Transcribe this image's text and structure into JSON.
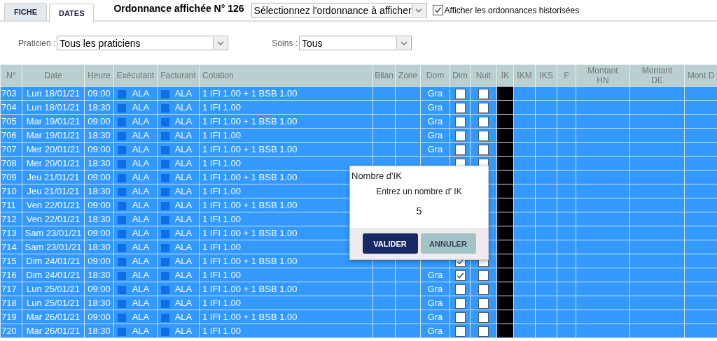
{
  "tabs": [
    {
      "label": "FICHE",
      "selected": false
    },
    {
      "label": "DATES",
      "selected": true
    }
  ],
  "title": "Ordonnance affichée N° 126",
  "ordonnance_select": {
    "value": "Sélectionnez l'ordonnance à afficher"
  },
  "show_history": {
    "label": "Afficher les ordonnances historisées",
    "checked": true
  },
  "filters": [
    {
      "label": "Praticien :",
      "value": "Tous les praticiens"
    },
    {
      "label": "Soins :",
      "value": "Tous"
    }
  ],
  "table": {
    "columns": [
      "N°",
      "Date",
      "Heure",
      "Exécutant",
      "Facturant",
      "Cotation",
      "Bilan",
      "Zone",
      "Dom",
      "Dim",
      "Nuit",
      "IK",
      "IKM",
      "IKS",
      "F",
      "Montant HN",
      "Montant DE",
      "Mont D"
    ],
    "rows": [
      {
        "num": "703",
        "date": "Lun 18/01/21",
        "time": "09:00",
        "executant": "ALA",
        "facturant": "ALA",
        "cotation": "1 IFI 1.00 + 1 BSB 1.00",
        "dom": "Gra",
        "dim": false,
        "nuit": false
      },
      {
        "num": "704",
        "date": "Lun 18/01/21",
        "time": "18:30",
        "executant": "ALA",
        "facturant": "ALA",
        "cotation": "1 IFI 1.00",
        "dom": "Gra",
        "dim": false,
        "nuit": false
      },
      {
        "num": "705",
        "date": "Mar 19/01/21",
        "time": "09:00",
        "executant": "ALA",
        "facturant": "ALA",
        "cotation": "1 IFI 1.00 + 1 BSB 1.00",
        "dom": "Gra",
        "dim": false,
        "nuit": false
      },
      {
        "num": "706",
        "date": "Mar 19/01/21",
        "time": "18:30",
        "executant": "ALA",
        "facturant": "ALA",
        "cotation": "1 IFI 1.00",
        "dom": "Gra",
        "dim": false,
        "nuit": false
      },
      {
        "num": "707",
        "date": "Mer 20/01/21",
        "time": "09:00",
        "executant": "ALA",
        "facturant": "ALA",
        "cotation": "1 IFI 1.00 + 1 BSB 1.00",
        "dom": "Gra",
        "dim": false,
        "nuit": false
      },
      {
        "num": "708",
        "date": "Mer 20/01/21",
        "time": "18:30",
        "executant": "ALA",
        "facturant": "ALA",
        "cotation": "1 IFI 1.00",
        "dim": false,
        "nuit": false
      },
      {
        "num": "709",
        "date": "Jeu 21/01/21",
        "time": "09:00",
        "executant": "ALA",
        "facturant": "ALA",
        "cotation": "1 IFI 1.00 + 1 BSB 1.00"
      },
      {
        "num": "710",
        "date": "Jeu 21/01/21",
        "time": "18:30",
        "executant": "ALA",
        "facturant": "ALA",
        "cotation": "1 IFI 1.00"
      },
      {
        "num": "711",
        "date": "Ven 22/01/21",
        "time": "09:00",
        "executant": "ALA",
        "facturant": "ALA",
        "cotation": "1 IFI 1.00 + 1 BSB 1.00"
      },
      {
        "num": "712",
        "date": "Ven 22/01/21",
        "time": "18:30",
        "executant": "ALA",
        "facturant": "ALA",
        "cotation": "1 IFI 1.00"
      },
      {
        "num": "713",
        "date": "Sam 23/01/21",
        "time": "09:00",
        "executant": "ALA",
        "facturant": "ALA",
        "cotation": "1 IFI 1.00 + 1 BSB 1.00"
      },
      {
        "num": "714",
        "date": "Sam 23/01/21",
        "time": "18:30",
        "executant": "ALA",
        "facturant": "ALA",
        "cotation": "1 IFI 1.00"
      },
      {
        "num": "715",
        "date": "Dim 24/01/21",
        "time": "09:00",
        "executant": "ALA",
        "facturant": "ALA",
        "cotation": "1 IFI 1.00 + 1 BSB 1.00",
        "dim": true,
        "nuit": false
      },
      {
        "num": "716",
        "date": "Dim 24/01/21",
        "time": "18:30",
        "executant": "ALA",
        "facturant": "ALA",
        "cotation": "1 IFI 1.00",
        "dom": "Gra",
        "dim": true,
        "nuit": false
      },
      {
        "num": "717",
        "date": "Lun 25/01/21",
        "time": "09:00",
        "executant": "ALA",
        "facturant": "ALA",
        "cotation": "1 IFI 1.00 + 1 BSB 1.00",
        "dom": "Gra",
        "dim": false,
        "nuit": false
      },
      {
        "num": "718",
        "date": "Lun 25/01/21",
        "time": "18:30",
        "executant": "ALA",
        "facturant": "ALA",
        "cotation": "1 IFI 1.00",
        "dom": "Gra",
        "dim": false,
        "nuit": false
      },
      {
        "num": "719",
        "date": "Mar 26/01/21",
        "time": "09:00",
        "executant": "ALA",
        "facturant": "ALA",
        "cotation": "1 IFI 1.00 + 1 BSB 1.00",
        "dom": "Gra",
        "dim": false,
        "nuit": false
      },
      {
        "num": "720",
        "date": "Mar 26/01/21",
        "time": "18:30",
        "executant": "ALA",
        "facturant": "ALA",
        "cotation": "1 IFI 1.00",
        "dom": "Gra",
        "dim": false,
        "nuit": false
      }
    ]
  },
  "dialog": {
    "title": "Nombre d'IK",
    "prompt": "Entrez un nombre d' IK",
    "value": "5",
    "buttons": [
      {
        "label": "VALIDER",
        "kind": "primary"
      },
      {
        "label": "ANNULER",
        "kind": "secondary"
      }
    ]
  }
}
